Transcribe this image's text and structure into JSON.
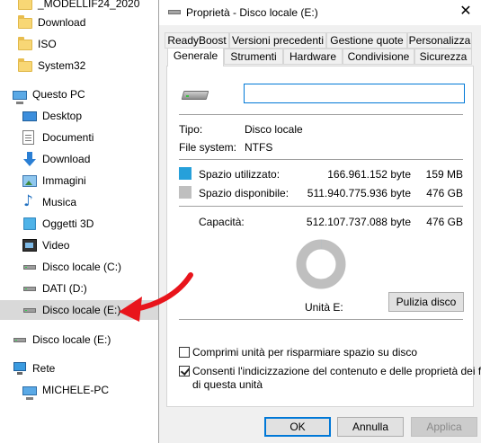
{
  "nav": {
    "items": [
      {
        "label": "_MODELLIF24_2020"
      },
      {
        "label": "Download"
      },
      {
        "label": "ISO"
      },
      {
        "label": "System32"
      },
      {
        "label": "Questo PC"
      },
      {
        "label": "Desktop"
      },
      {
        "label": "Documenti"
      },
      {
        "label": "Download"
      },
      {
        "label": "Immagini"
      },
      {
        "label": "Musica"
      },
      {
        "label": "Oggetti 3D"
      },
      {
        "label": "Video"
      },
      {
        "label": "Disco locale (C:)"
      },
      {
        "label": "DATI (D:)"
      },
      {
        "label": "Disco locale (E:)"
      },
      {
        "label": "Disco locale (E:)"
      },
      {
        "label": "Rete"
      },
      {
        "label": "MICHELE-PC"
      }
    ]
  },
  "dialog": {
    "title": "Proprietà - Disco locale (E:)",
    "close_glyph": "✕",
    "tabs_row1": [
      "ReadyBoost",
      "Versioni precedenti",
      "Gestione quote",
      "Personalizza"
    ],
    "tabs_row2": [
      "Generale",
      "Strumenti",
      "Hardware",
      "Condivisione",
      "Sicurezza"
    ],
    "name_input": {
      "value": "",
      "placeholder": ""
    },
    "type_label": "Tipo:",
    "type_value": "Disco locale",
    "fs_label": "File system:",
    "fs_value": "NTFS",
    "used_label": "Spazio utilizzato:",
    "used_bytes": "166.961.152 byte",
    "used_size": "159 MB",
    "free_label": "Spazio disponibile:",
    "free_bytes": "511.940.775.936 byte",
    "free_size": "476 GB",
    "cap_label": "Capacità:",
    "cap_bytes": "512.107.737.088 byte",
    "cap_size": "476 GB",
    "drive_label": "Unità E:",
    "cleanup_button": "Pulizia disco",
    "compress_label": "Comprimi unità per risparmiare spazio su disco",
    "compress_checked": false,
    "index_label_line1": "Consenti l'indicizzazione del contenuto e delle proprietà dei file",
    "index_label_line2": "di questa unità",
    "index_checked": true,
    "ok_button": "OK",
    "cancel_button": "Annulla",
    "apply_button": "Applica"
  },
  "chart_data": {
    "type": "pie",
    "categories": [
      "Spazio utilizzato",
      "Spazio disponibile"
    ],
    "values": [
      166961152,
      511940775936
    ]
  },
  "colors": {
    "used": "#26a0da",
    "free": "#bfbfbf",
    "accent": "#0078d7",
    "arrow": "#e8141b",
    "selection": "#d9d9d9"
  }
}
